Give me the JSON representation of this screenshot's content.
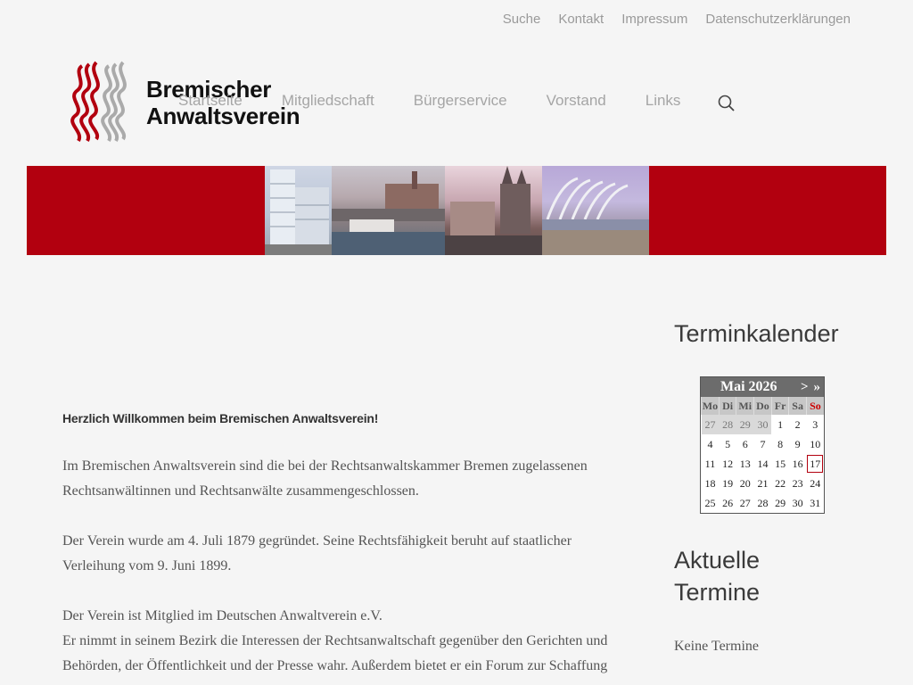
{
  "topnav": [
    "Suche",
    "Kontakt",
    "Impressum",
    "Datenschutzerklärungen"
  ],
  "logo": {
    "line1": "Bremischer",
    "line2": "Anwaltsverein"
  },
  "mainnav": [
    "Startseite",
    "Mitgliedschaft",
    "Bürgerservice",
    "Vorstand",
    "Links"
  ],
  "search_icon": "search-icon",
  "colors": {
    "accent": "#b2000f",
    "nav": "#a5a5a5"
  },
  "content": {
    "welcome": "Herzlich Willkommen beim Bremischen Anwaltsverein!",
    "p1": "Im Bremischen Anwaltsverein sind die bei der Rechtsanwaltskammer Bremen zugelassenen Rechtsanwältinnen und Rechtsanwälte zusammengeschlossen.",
    "p2": "Der Verein wurde am 4. Juli 1879 gegründet. Seine Rechtsfähigkeit beruht auf staatlicher Verleihung vom 9. Juni 1899.",
    "p3a": "Der Verein ist Mitglied im Deutschen Anwaltverein e.V.",
    "p3b": "Er nimmt in seinem Bezirk die Interessen der Rechtsanwaltschaft gegenüber den Gerichten und Behörden, der Öffentlichkeit und der Presse wahr. Außerdem bietet er ein Forum zur Schaffung"
  },
  "sidebar": {
    "calendar_title": "Terminkalender",
    "events_title_1": "Aktuelle",
    "events_title_2": "Termine",
    "no_events": "Keine Termine"
  },
  "calendar": {
    "month": "Mai 2026",
    "next": ">",
    "next_year": "»",
    "weekdays": [
      "Mo",
      "Di",
      "Mi",
      "Do",
      "Fr",
      "Sa",
      "So"
    ],
    "weeks": [
      [
        "27",
        "28",
        "29",
        "30",
        "1",
        "2",
        "3"
      ],
      [
        "4",
        "5",
        "6",
        "7",
        "8",
        "9",
        "10"
      ],
      [
        "11",
        "12",
        "13",
        "14",
        "15",
        "16",
        "17"
      ],
      [
        "18",
        "19",
        "20",
        "21",
        "22",
        "23",
        "24"
      ],
      [
        "25",
        "26",
        "27",
        "28",
        "29",
        "30",
        "31"
      ]
    ],
    "other_month_cells": 4,
    "today": "17"
  }
}
